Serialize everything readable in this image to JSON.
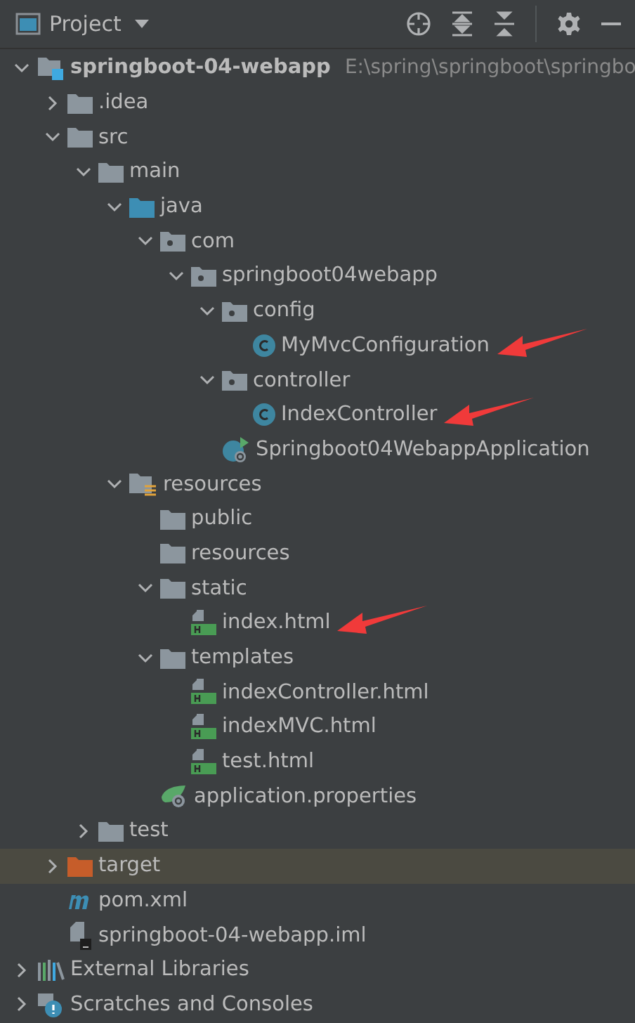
{
  "header": {
    "title": "Project"
  },
  "tree": [
    {
      "label": "springboot-04-webapp",
      "hint": "E:\\spring\\springboot\\springbo",
      "kind": "module",
      "expanded": true,
      "selected": false,
      "children": [
        {
          "label": ".idea",
          "kind": "folder",
          "expanded": false,
          "selected": false
        },
        {
          "label": "src",
          "kind": "folder",
          "expanded": true,
          "selected": false,
          "children": [
            {
              "label": "main",
              "kind": "folder",
              "expanded": true,
              "selected": false,
              "children": [
                {
                  "label": "java",
                  "kind": "source-folder",
                  "expanded": true,
                  "selected": false,
                  "children": [
                    {
                      "label": "com",
                      "kind": "package",
                      "expanded": true,
                      "selected": false,
                      "children": [
                        {
                          "label": "springboot04webapp",
                          "kind": "package",
                          "expanded": true,
                          "selected": false,
                          "children": [
                            {
                              "label": "config",
                              "kind": "package",
                              "expanded": true,
                              "selected": false,
                              "children": [
                                {
                                  "label": "MyMvcConfiguration",
                                  "kind": "class",
                                  "selected": false,
                                  "marked": true
                                }
                              ]
                            },
                            {
                              "label": "controller",
                              "kind": "package",
                              "expanded": true,
                              "selected": false,
                              "children": [
                                {
                                  "label": "IndexController",
                                  "kind": "class",
                                  "selected": false,
                                  "marked": true
                                }
                              ]
                            },
                            {
                              "label": "Springboot04WebappApplication",
                              "kind": "spring-app",
                              "selected": false
                            }
                          ]
                        }
                      ]
                    }
                  ]
                },
                {
                  "label": "resources",
                  "kind": "resources-folder",
                  "expanded": true,
                  "selected": false,
                  "children": [
                    {
                      "label": "public",
                      "kind": "folder",
                      "selected": false
                    },
                    {
                      "label": "resources",
                      "kind": "folder",
                      "selected": false
                    },
                    {
                      "label": "static",
                      "kind": "folder",
                      "expanded": true,
                      "selected": false,
                      "children": [
                        {
                          "label": "index.html",
                          "kind": "html",
                          "selected": false,
                          "marked": true
                        }
                      ]
                    },
                    {
                      "label": "templates",
                      "kind": "folder",
                      "expanded": true,
                      "selected": false,
                      "children": [
                        {
                          "label": "indexController.html",
                          "kind": "html",
                          "selected": false
                        },
                        {
                          "label": "indexMVC.html",
                          "kind": "html",
                          "selected": false
                        },
                        {
                          "label": "test.html",
                          "kind": "html",
                          "selected": false
                        }
                      ]
                    },
                    {
                      "label": "application.properties",
                      "kind": "properties",
                      "selected": false
                    }
                  ]
                }
              ]
            },
            {
              "label": "test",
              "kind": "folder",
              "expanded": false,
              "selected": false
            }
          ]
        },
        {
          "label": "target",
          "kind": "excluded-folder",
          "expanded": false,
          "selected": true
        },
        {
          "label": "pom.xml",
          "kind": "maven",
          "selected": false
        },
        {
          "label": "springboot-04-webapp.iml",
          "kind": "iml",
          "selected": false
        }
      ]
    },
    {
      "label": "External Libraries",
      "kind": "libraries",
      "expanded": false,
      "selected": false
    },
    {
      "label": "Scratches and Consoles",
      "kind": "scratches",
      "expanded": false,
      "selected": false
    }
  ]
}
